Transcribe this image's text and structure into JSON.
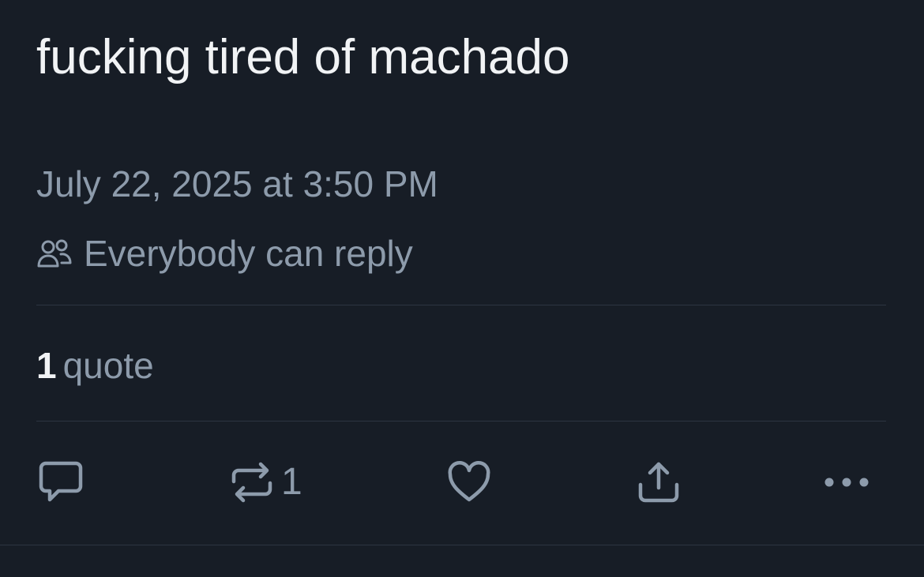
{
  "post": {
    "text": "fucking tired of machado",
    "timestamp": "July 22, 2025 at 3:50 PM",
    "reply_setting": {
      "icon": "people-icon",
      "label": "Everybody can reply"
    },
    "quotes": {
      "count": "1",
      "label": "quote"
    }
  },
  "actions": {
    "reply": {
      "icon": "reply-icon"
    },
    "repost": {
      "icon": "repost-icon",
      "count": "1"
    },
    "like": {
      "icon": "heart-icon"
    },
    "share": {
      "icon": "share-icon"
    },
    "more": {
      "icon": "more-icon"
    }
  },
  "colors": {
    "background": "#171d26",
    "primary_text": "#f1f3f5",
    "secondary_text": "#8d9bab",
    "divider": "#2c3541"
  }
}
